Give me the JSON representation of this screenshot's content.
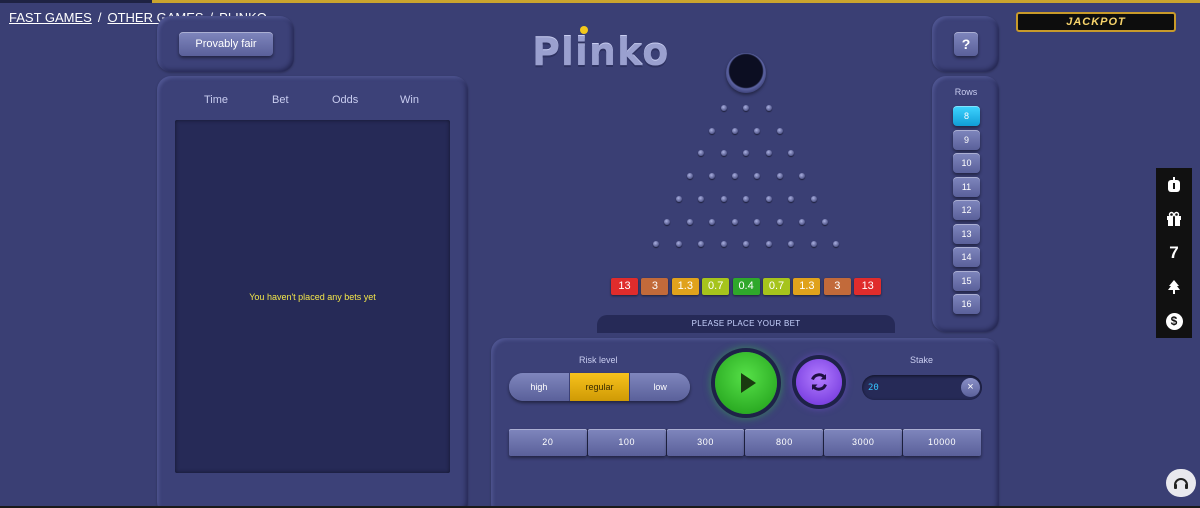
{
  "breadcrumb": {
    "fast_games": "FAST GAMES",
    "sep1": "/",
    "other_games": "OTHER GAMES",
    "sep2": "/",
    "current": "PLINKO"
  },
  "header": {
    "provably_fair": "Provably fair",
    "logo_text": "Plinko",
    "help": "?",
    "jackpot": "JACKPOT"
  },
  "history": {
    "columns": [
      "Time",
      "Bet",
      "Odds",
      "Win"
    ],
    "empty_message": "You haven't placed any bets yet"
  },
  "board": {
    "buckets": [
      {
        "value": "13",
        "color": "#e02c2c"
      },
      {
        "value": "3",
        "color": "#c26a3a"
      },
      {
        "value": "1.3",
        "color": "#e0a21c"
      },
      {
        "value": "0.7",
        "color": "#a6c41c"
      },
      {
        "value": "0.4",
        "color": "#2fa82b"
      },
      {
        "value": "0.7",
        "color": "#a6c41c"
      },
      {
        "value": "1.3",
        "color": "#e0a21c"
      },
      {
        "value": "3",
        "color": "#c26a3a"
      },
      {
        "value": "13",
        "color": "#e02c2c"
      }
    ],
    "status": "PLEASE PLACE YOUR BET"
  },
  "rows": {
    "title": "Rows",
    "options": [
      "8",
      "9",
      "10",
      "11",
      "12",
      "13",
      "14",
      "15",
      "16"
    ],
    "selected": "8"
  },
  "controls": {
    "risk_label": "Risk level",
    "risk_options": [
      "high",
      "regular",
      "low"
    ],
    "risk_selected": "regular",
    "stake_label": "Stake",
    "stake_value": "20",
    "clear": "×",
    "presets": [
      "20",
      "100",
      "300",
      "800",
      "3000",
      "10000"
    ]
  },
  "side_tools": {
    "seven": "7",
    "dollar": "$"
  },
  "colors": {
    "background": "#3a3f74",
    "accent": "#f7c21c",
    "play": "#2fbf2a",
    "auto": "#8a4dff",
    "active_row": "#1fb5ea"
  }
}
